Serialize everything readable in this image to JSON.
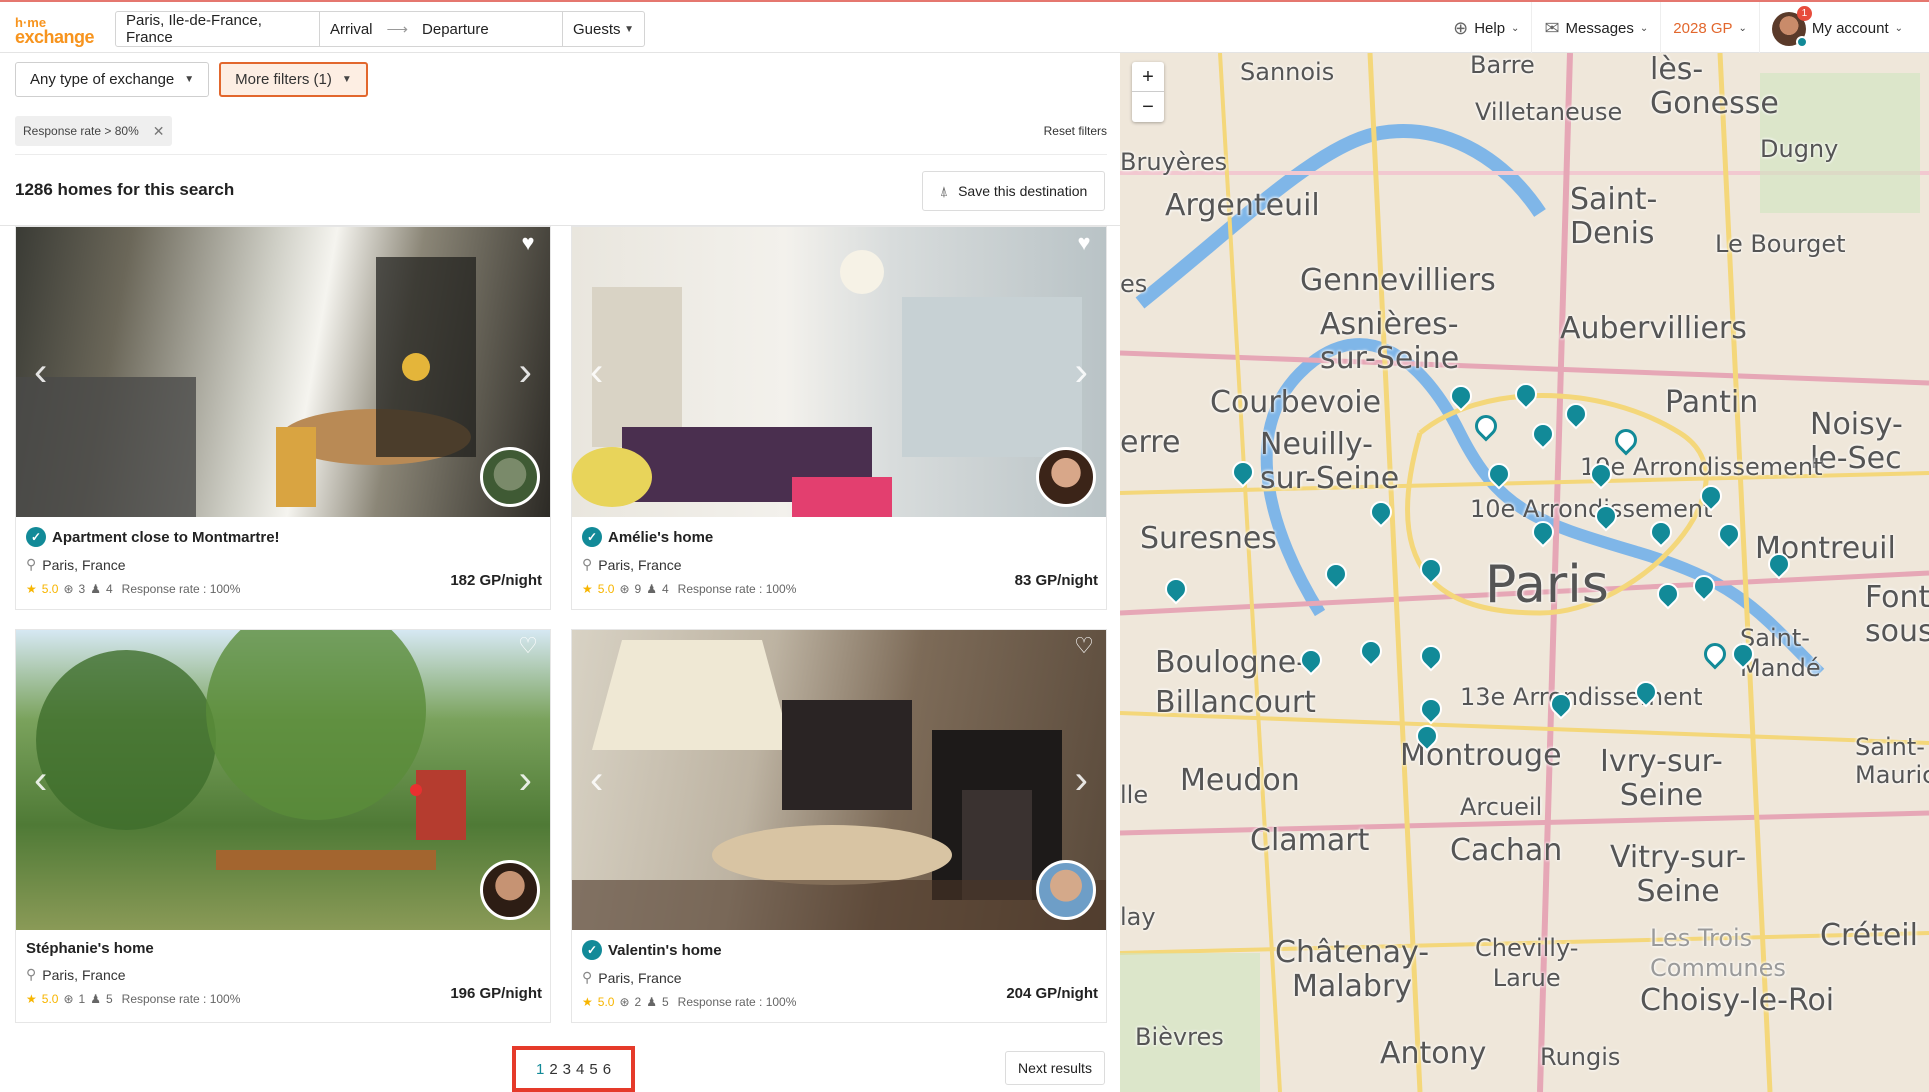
{
  "header": {
    "logo_line1": "h·me",
    "logo_line2": "exchange",
    "destination": "Paris, Ile-de-France, France",
    "arrival": "Arrival",
    "departure": "Departure",
    "guests": "Guests",
    "help": "Help",
    "messages": "Messages",
    "points": "2028 GP",
    "account": "My account",
    "notification_count": "1"
  },
  "filters": {
    "exchange_type": "Any type of exchange",
    "more_filters": "More filters (1)",
    "active_chip": "Response rate > 80%",
    "reset": "Reset filters"
  },
  "results": {
    "count_text": "1286 homes for this search",
    "save_destination": "Save this destination"
  },
  "listings": [
    {
      "title": "Apartment close to Montmartre!",
      "verified": true,
      "location": "Paris, France",
      "rating": "5.0",
      "bedrooms": "3",
      "guests": "4",
      "response": "Response rate : 100%",
      "price": "182 GP/night"
    },
    {
      "title": "Amélie's home",
      "verified": true,
      "location": "Paris, France",
      "rating": "5.0",
      "bedrooms": "9",
      "guests": "4",
      "response": "Response rate : 100%",
      "price": "83 GP/night"
    },
    {
      "title": "Stéphanie's home",
      "verified": false,
      "location": "Paris, France",
      "rating": "5.0",
      "bedrooms": "1",
      "guests": "5",
      "response": "Response rate : 100%",
      "price": "196 GP/night"
    },
    {
      "title": "Valentin's home",
      "verified": true,
      "location": "Paris, France",
      "rating": "5.0",
      "bedrooms": "2",
      "guests": "5",
      "response": "Response rate : 100%",
      "price": "204 GP/night"
    }
  ],
  "pagination": {
    "pages": [
      "1",
      "2",
      "3",
      "4",
      "5",
      "6"
    ],
    "next": "Next results"
  },
  "map": {
    "zoom_in": "+",
    "zoom_out": "−",
    "labels": {
      "sannois": "Sannois",
      "barre": "Barre",
      "lesgonesse": "lès-\nGonesse",
      "villetaneuse": "Villetaneuse",
      "dugny": "Dugny",
      "bruyeres": "Bruyères",
      "argenteuil": "Argenteuil",
      "saintdenis": "Saint-\nDenis",
      "lebourget": "Le Bourget",
      "gennevilliers": "Gennevilliers",
      "asnieres": "Asnières-\nsur-Seine",
      "aubervilliers": "Aubervilliers",
      "courbevoie": "Courbevoie",
      "pantin": "Pantin",
      "neuilly": "Neuilly-\nsur-Seine",
      "noisy": "Noisy-\nle-Sec",
      "arr19": "19e Arrondissement",
      "arr10": "10e Arrondissement",
      "suresnes": "Suresnes",
      "montreuil": "Montreuil",
      "paris": "Paris",
      "boulogne": "Boulogne-\nBillancourt",
      "saintmande": "Saint-\nMandé",
      "arr13": "13e Arrondissement",
      "fontenay": "Font\nsous",
      "meudon": "Meudon",
      "montrouge": "Montrouge",
      "ivry": "Ivry-sur-\nSeine",
      "arcueil": "Arcueil",
      "clamart": "Clamart",
      "cachan": "Cachan",
      "vitry": "Vitry-sur-\nSeine",
      "chatenay": "Châtenay-\nMalabry",
      "chevilly": "Chevilly-\nLarue",
      "troiscommunes": "Les Trois\nCommunes",
      "choisy": "Choisy-le-Roi",
      "creteil": "Créteil",
      "antony": "Antony",
      "rungis": "Rungis",
      "bievres": "Bièvres",
      "saintmaurice": "Saint-\nMaurice",
      "erre": "erre",
      "es": "es",
      "lay": "lay",
      "lle": "lle"
    }
  }
}
